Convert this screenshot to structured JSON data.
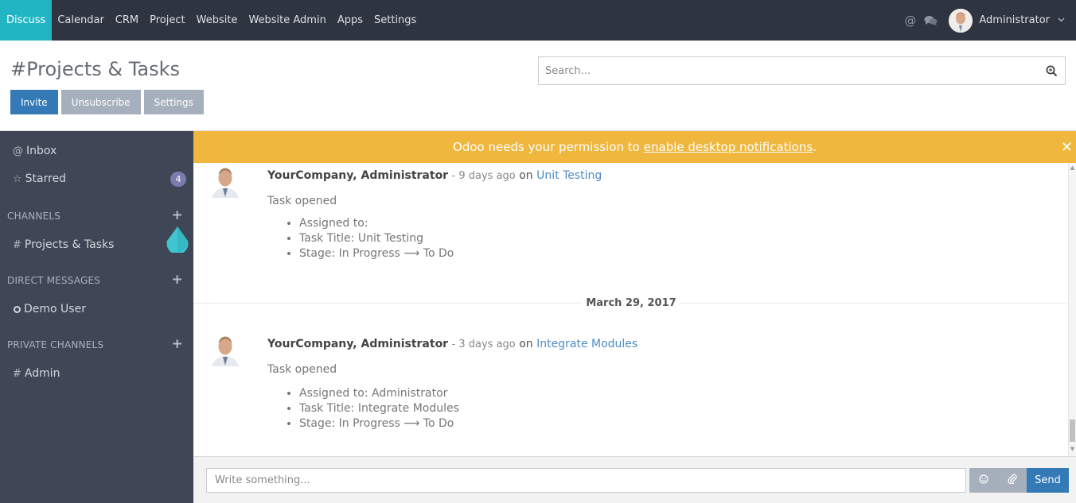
{
  "navbar": {
    "menu": [
      {
        "label": "Discuss",
        "active": true
      },
      {
        "label": "Calendar"
      },
      {
        "label": "CRM"
      },
      {
        "label": "Project"
      },
      {
        "label": "Website"
      },
      {
        "label": "Website Admin"
      },
      {
        "label": "Apps"
      },
      {
        "label": "Settings"
      }
    ],
    "icons": [
      "at-icon",
      "chat-bubbles-icon"
    ],
    "user_name": "Administrator"
  },
  "control_panel": {
    "title": "#Projects & Tasks",
    "buttons": {
      "invite": "Invite",
      "unsubscribe": "Unsubscribe",
      "settings": "Settings"
    },
    "search_placeholder": "Search..."
  },
  "sidebar": {
    "inbox": "Inbox",
    "starred": "Starred",
    "starred_count": "4",
    "channels_header": "CHANNELS",
    "channels": [
      {
        "label": "Projects & Tasks"
      }
    ],
    "direct_header": "DIRECT MESSAGES",
    "direct": [
      {
        "label": "Demo User"
      }
    ],
    "private_header": "PRIVATE CHANNELS",
    "private": [
      {
        "label": "Admin"
      }
    ]
  },
  "notification": {
    "text": "Odoo needs your permission to",
    "link": "enable desktop notifications",
    "suffix": ".",
    "color": "#efb73e"
  },
  "thread": {
    "messages": [
      {
        "author": "YourCompany, Administrator",
        "date": "- 9 days ago",
        "on": "on",
        "record": "Unit Testing",
        "body": "Task opened",
        "tracking": [
          "Assigned to:",
          "Task Title: Unit Testing",
          "Stage: In Progress ⟶ To Do"
        ]
      },
      {
        "author": "YourCompany, Administrator",
        "date": "- 3 days ago",
        "on": "on",
        "record": "Integrate Modules",
        "body": "Task opened",
        "tracking": [
          "Assigned to: Administrator",
          "Task Title: Integrate Modules",
          "Stage: In Progress ⟶ To Do"
        ]
      }
    ],
    "date_separator": "March 29, 2017"
  },
  "composer": {
    "placeholder": "Write something...",
    "send_label": "Send"
  },
  "colors": {
    "navbar": "#2f3441",
    "active_app": "#21b5c3",
    "primary": "#337ab7",
    "sidebar": "#3f4756",
    "badge": "#7c7bad"
  }
}
